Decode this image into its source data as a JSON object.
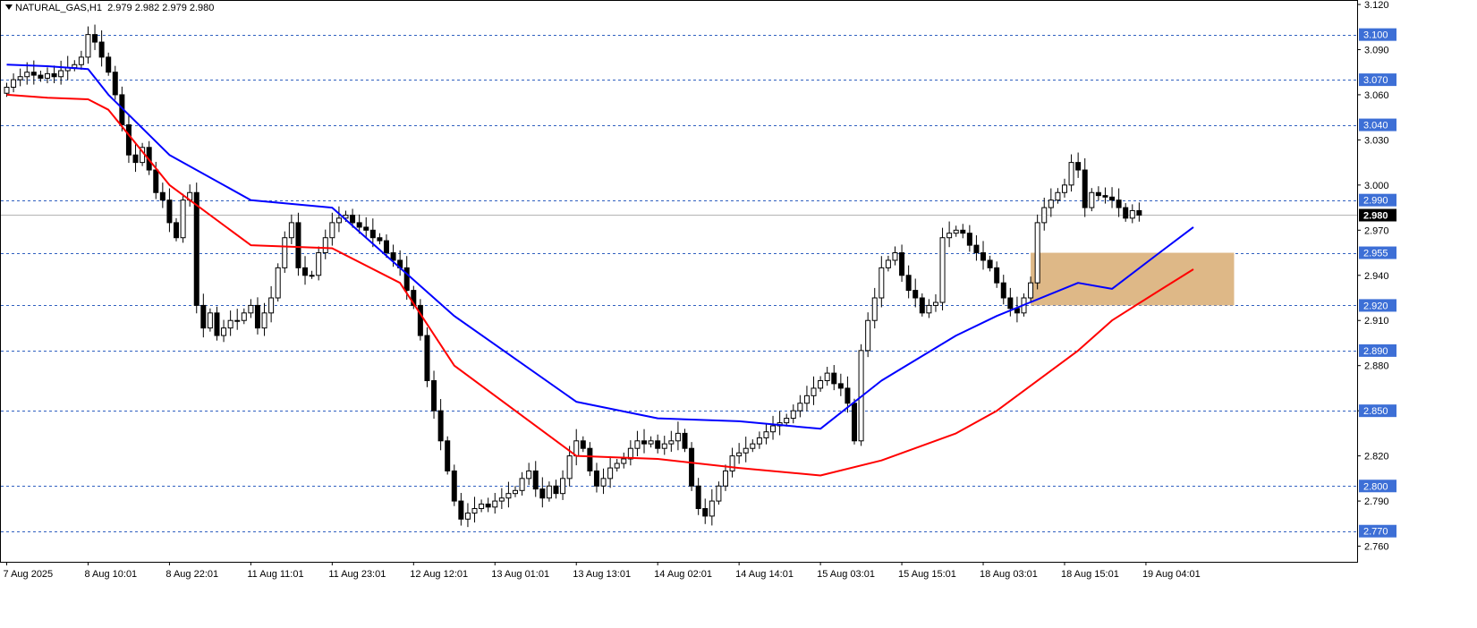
{
  "header": {
    "symbol_line": "NATURAL_GAS,H1",
    "ohlc_line": "2.979 2.982 2.979 2.980"
  },
  "colors": {
    "background": "#ffffff",
    "level_line": "#3060c0",
    "level_label_bg": "#3d6fd6",
    "ma_fast": "#0000ff",
    "ma_slow": "#ff0000",
    "zone_fill": "#deb887",
    "current_price_line": "#b4b4b4"
  },
  "chart_data": {
    "type": "candlestick",
    "title": "NATURAL_GAS,H1",
    "ylim": [
      2.752,
      3.12
    ],
    "y_ticks": [
      "3.120",
      "3.090",
      "3.060",
      "3.030",
      "3.000",
      "2.970",
      "2.940",
      "2.910",
      "2.880",
      "2.850",
      "2.820",
      "2.790",
      "2.760"
    ],
    "x_ticks": [
      "7 Aug 2025",
      "8 Aug 10:01",
      "8 Aug 22:01",
      "11 Aug 11:01",
      "11 Aug 23:01",
      "12 Aug 12:01",
      "13 Aug 01:01",
      "13 Aug 13:01",
      "14 Aug 02:01",
      "14 Aug 14:01",
      "15 Aug 03:01",
      "15 Aug 15:01",
      "18 Aug 03:01",
      "18 Aug 15:01",
      "19 Aug 04:01"
    ],
    "x_tick_bars": [
      0,
      12,
      24,
      36,
      48,
      60,
      72,
      84,
      96,
      108,
      120,
      132,
      144,
      156,
      168
    ],
    "horizontal_levels": [
      "3.100",
      "3.070",
      "3.040",
      "2.990",
      "2.955",
      "2.920",
      "2.890",
      "2.850",
      "2.800",
      "2.770"
    ],
    "current_price": "2.980",
    "zone": {
      "y_from": 2.92,
      "y_to": 2.955,
      "bar_from": 151,
      "bar_to": 181
    },
    "close": [
      3.065,
      3.07,
      3.072,
      3.075,
      3.073,
      3.071,
      3.074,
      3.072,
      3.076,
      3.078,
      3.08,
      3.085,
      3.1,
      3.095,
      3.085,
      3.075,
      3.06,
      3.04,
      3.02,
      3.015,
      3.025,
      3.01,
      2.995,
      2.99,
      2.975,
      2.965,
      2.99,
      2.995,
      2.92,
      2.905,
      2.915,
      2.9,
      2.905,
      2.91,
      2.91,
      2.915,
      2.92,
      2.905,
      2.915,
      2.925,
      2.945,
      2.965,
      2.975,
      2.945,
      2.94,
      2.94,
      2.955,
      2.965,
      2.975,
      2.978,
      2.98,
      2.975,
      2.972,
      2.97,
      2.965,
      2.963,
      2.955,
      2.95,
      2.945,
      2.93,
      2.92,
      2.9,
      2.87,
      2.85,
      2.83,
      2.81,
      2.79,
      2.778,
      2.782,
      2.785,
      2.788,
      2.786,
      2.79,
      2.792,
      2.795,
      2.797,
      2.805,
      2.81,
      2.798,
      2.792,
      2.8,
      2.795,
      2.805,
      2.82,
      2.83,
      2.825,
      2.81,
      2.8,
      2.805,
      2.812,
      2.815,
      2.818,
      2.825,
      2.83,
      2.828,
      2.83,
      2.825,
      2.828,
      2.83,
      2.835,
      2.825,
      2.8,
      2.785,
      2.78,
      2.79,
      2.8,
      2.81,
      2.82,
      2.822,
      2.825,
      2.828,
      2.832,
      2.836,
      2.84,
      2.842,
      2.845,
      2.85,
      2.855,
      2.86,
      2.865,
      2.87,
      2.875,
      2.868,
      2.865,
      2.855,
      2.83,
      2.89,
      2.91,
      2.925,
      2.945,
      2.95,
      2.955,
      2.94,
      2.93,
      2.925,
      2.915,
      2.92,
      2.922,
      2.965,
      2.968,
      2.97,
      2.968,
      2.96,
      2.955,
      2.95,
      2.945,
      2.935,
      2.925,
      2.918,
      2.915,
      2.925,
      2.935,
      2.975,
      2.985,
      2.99,
      2.995,
      3.0,
      3.015,
      3.01,
      2.985,
      2.995,
      2.993,
      2.992,
      2.99,
      2.985,
      2.978,
      2.983,
      2.98
    ],
    "fast_ma": [
      3.08,
      3.079,
      3.077,
      3.06,
      3.02,
      2.99,
      2.985,
      2.945,
      2.913,
      2.856,
      2.845,
      2.843,
      2.838,
      2.87,
      2.9,
      2.913,
      2.935,
      2.931,
      2.955,
      2.972
    ],
    "slow_ma": [
      3.06,
      3.058,
      3.057,
      3.05,
      3.0,
      2.96,
      2.958,
      2.935,
      2.88,
      2.82,
      2.818,
      2.812,
      2.807,
      2.817,
      2.835,
      2.85,
      2.89,
      2.91,
      2.93,
      2.944
    ],
    "ma_knot_bars": [
      0,
      6,
      12,
      15,
      24,
      36,
      48,
      58,
      66,
      84,
      96,
      108,
      120,
      129,
      140,
      146,
      158,
      163,
      170,
      175
    ]
  }
}
